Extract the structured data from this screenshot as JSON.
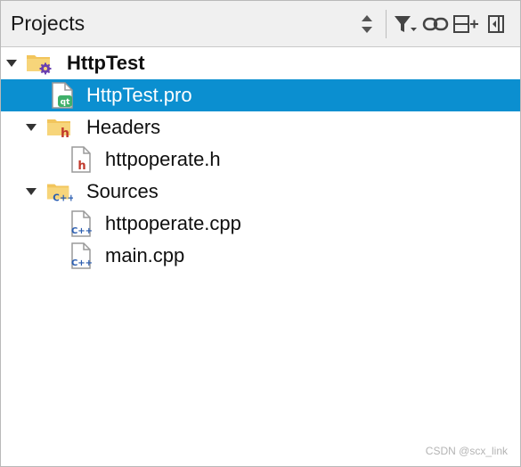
{
  "panel": {
    "title": "Projects",
    "toolbar_icons": [
      "sort-updown-icon",
      "filter-icon",
      "link-icon",
      "split-add-icon",
      "close-sidebar-icon"
    ]
  },
  "tree": {
    "project": {
      "label": "HttpTest",
      "expanded": true,
      "icon": "project-folder-gear-icon"
    },
    "pro_file": {
      "label": "HttpTest.pro",
      "selected": true,
      "icon": "qt-pro-file-icon"
    },
    "headers": {
      "label": "Headers",
      "expanded": true,
      "icon": "headers-folder-icon",
      "items": [
        {
          "label": "httpoperate.h",
          "icon": "header-file-icon"
        }
      ]
    },
    "sources": {
      "label": "Sources",
      "expanded": true,
      "icon": "sources-folder-icon",
      "items": [
        {
          "label": "httpoperate.cpp",
          "icon": "cpp-file-icon"
        },
        {
          "label": "main.cpp",
          "icon": "cpp-file-icon"
        }
      ]
    }
  },
  "watermark": "CSDN @scx_link",
  "colors": {
    "selection": "#0b8fd0",
    "toolbar_bg": "#f0f0f0",
    "folder": "#f2c55c",
    "gear": "#6a3fb0",
    "header_h": "#c0392b",
    "cpp": "#2a5db0",
    "qt_green": "#3fb06a"
  }
}
